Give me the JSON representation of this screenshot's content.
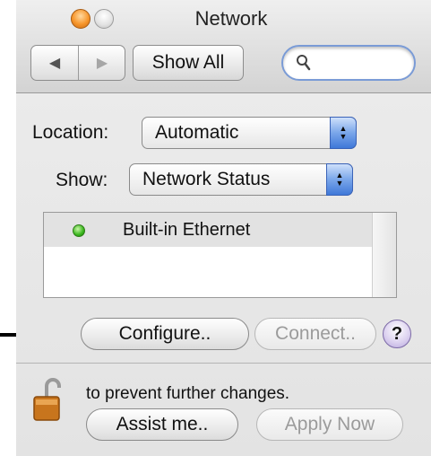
{
  "window": {
    "title": "Network"
  },
  "toolbar": {
    "show_all_label": "Show All",
    "search_placeholder": ""
  },
  "location": {
    "label": "Location:",
    "value": "Automatic"
  },
  "show": {
    "label": "Show:",
    "value": "Network Status"
  },
  "services": [
    {
      "name": "Built-in Ethernet",
      "status_color": "#39b61d"
    }
  ],
  "buttons": {
    "configure": "Configure..",
    "connect": "Connect..",
    "help": "?",
    "assist": "Assist me..",
    "apply": "Apply Now"
  },
  "lock": {
    "text": "to prevent further changes."
  },
  "colors": {
    "close_light": "#f7962b",
    "accent_blue": "#3f78d8",
    "status_green": "#39b61d"
  }
}
